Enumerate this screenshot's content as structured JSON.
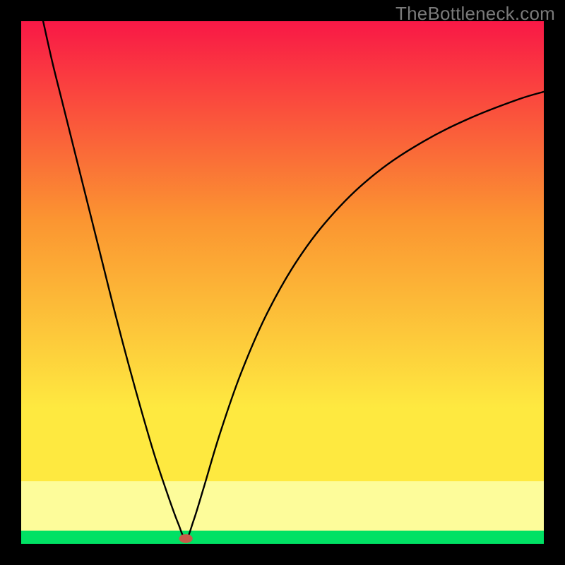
{
  "watermark": "TheBottleneck.com",
  "chart_data": {
    "type": "line",
    "title": "",
    "xlabel": "",
    "ylabel": "",
    "xlim": [
      0,
      100
    ],
    "ylim": [
      0,
      100
    ],
    "legend": [],
    "annotations": [],
    "background_gradient": {
      "top": "#f91846",
      "mid_upper": "#fb9531",
      "mid_lower": "#fee940",
      "bottom_bar": "#fdfc9a",
      "base": "#00e164"
    },
    "frame_color": "#000000",
    "curves": {
      "left_branch": {
        "description": "Descending left arm of V (concave)",
        "points": [
          {
            "x": 4.2,
            "y": 100.0
          },
          {
            "x": 6.0,
            "y": 92.0
          },
          {
            "x": 8.0,
            "y": 84.0
          },
          {
            "x": 10.5,
            "y": 74.0
          },
          {
            "x": 13.0,
            "y": 64.0
          },
          {
            "x": 15.5,
            "y": 54.0
          },
          {
            "x": 18.0,
            "y": 44.0
          },
          {
            "x": 20.5,
            "y": 34.5
          },
          {
            "x": 23.0,
            "y": 25.5
          },
          {
            "x": 25.5,
            "y": 17.0
          },
          {
            "x": 28.0,
            "y": 9.5
          },
          {
            "x": 30.0,
            "y": 4.0
          },
          {
            "x": 31.5,
            "y": 1.0
          }
        ]
      },
      "right_branch": {
        "description": "Ascending right arm (rising with decreasing slope)",
        "points": [
          {
            "x": 31.5,
            "y": 1.0
          },
          {
            "x": 33.0,
            "y": 4.5
          },
          {
            "x": 35.0,
            "y": 11.0
          },
          {
            "x": 38.0,
            "y": 21.0
          },
          {
            "x": 42.0,
            "y": 32.5
          },
          {
            "x": 47.0,
            "y": 44.0
          },
          {
            "x": 53.0,
            "y": 54.5
          },
          {
            "x": 60.0,
            "y": 63.5
          },
          {
            "x": 68.0,
            "y": 71.0
          },
          {
            "x": 77.0,
            "y": 77.0
          },
          {
            "x": 86.0,
            "y": 81.5
          },
          {
            "x": 95.0,
            "y": 85.0
          },
          {
            "x": 100.0,
            "y": 86.5
          }
        ]
      }
    },
    "marker": {
      "x": 31.5,
      "y": 1.0,
      "color": "#c85a4a",
      "rx": 1.3,
      "ry": 0.85
    }
  }
}
